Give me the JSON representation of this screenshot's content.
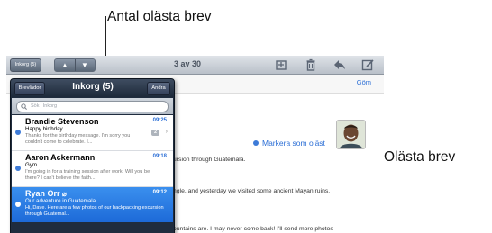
{
  "callouts": {
    "unread_count": "Antal olästa brev",
    "unread_mail": "Olästa brev"
  },
  "toolbar": {
    "inbox_button": "Inkorg (5)",
    "message_counter": "3 av 30",
    "icons": [
      "folder-icon",
      "trash-icon",
      "reply-icon",
      "compose-icon"
    ]
  },
  "detail": {
    "hide_label": "Göm",
    "mark_unread_label": "Markera som oläst",
    "body_lines": [
      "ursion through Guatemala.",
      "ngle, and yesterday we visited some ancient Mayan ruins.",
      "ountains are. I may never come back! I'll send more photos"
    ]
  },
  "popover": {
    "mailboxes_button": "Brevlådor",
    "title": "Inkorg (5)",
    "edit_button": "Ändra",
    "search_placeholder": "Sök i Inkorg",
    "messages": [
      {
        "sender": "Brandie Stevenson",
        "time": "09:25",
        "subject": "Happy birthday",
        "preview": "Thanks for the birthday message. I'm sorry you couldn't come to celebrate. I...",
        "thread_count": "2",
        "unread": true,
        "selected": false
      },
      {
        "sender": "Aaron Ackermann",
        "time": "09:18",
        "subject": "Gym",
        "preview": "I'm going in for a training session after work. Will you be there? I can't believe the faith...",
        "unread": true,
        "selected": false
      },
      {
        "sender": "Ryan Orr",
        "time": "09:12",
        "subject": "Our adventure in Guatemala",
        "preview": "Hi, Dave. Here are a few photos of our backpacking excursion through Guatemal...",
        "unread": true,
        "selected": true
      }
    ]
  },
  "colors": {
    "accent_blue": "#2c6fd6",
    "selection_blue": "#1d6ad8",
    "popover_dark": "#1f2c3e"
  }
}
